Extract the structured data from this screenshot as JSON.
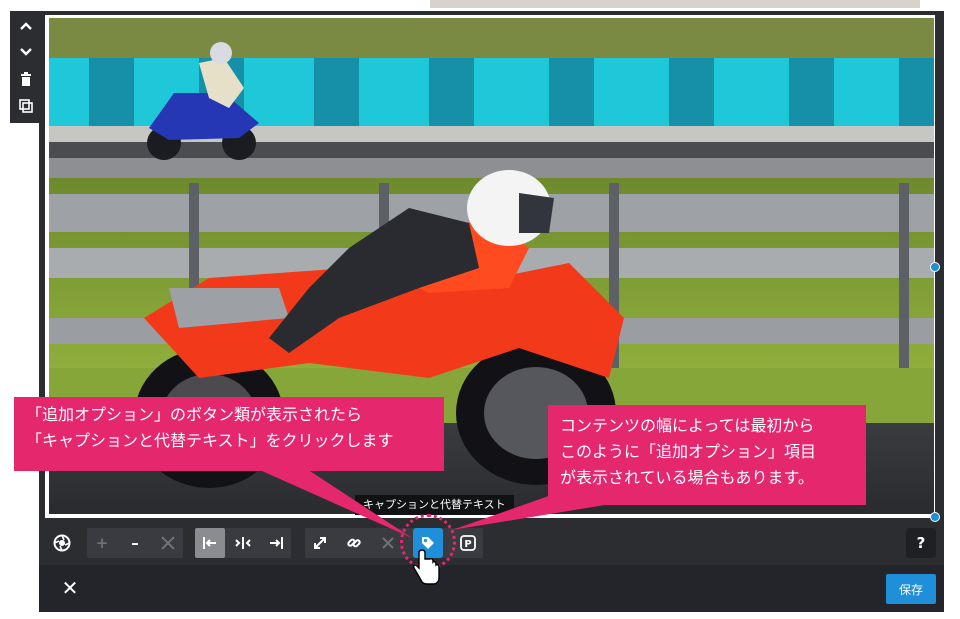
{
  "callouts": {
    "left": [
      "「追加オプション」のボタン類が表示されたら",
      "「キャプションと代替テキスト」をクリックします"
    ],
    "right": [
      "コンテンツの幅によっては最初から",
      "このように「追加オプション」項目",
      "が表示されている場合もあります。"
    ]
  },
  "tooltip": {
    "text": "キャプションと代替テキスト"
  },
  "bottombar": {
    "save_label": "保存",
    "close_label": "✕"
  },
  "toolbar": {
    "help_label": "?"
  },
  "colors": {
    "accent": "#1e8fd8",
    "callout": "#e5276e",
    "panel": "#2b2d31"
  },
  "icons": {
    "sidebar": [
      "chevron-up-icon",
      "chevron-down-icon",
      "trash-icon",
      "duplicate-icon"
    ],
    "toolbar": [
      "aperture-icon",
      "plus-icon",
      "minus-icon",
      "fullsize-icon",
      "align-left-icon",
      "align-center-icon",
      "align-right-icon",
      "resize-icon",
      "link-icon",
      "unlink-icon",
      "tag-icon",
      "pinterest-icon",
      "help-icon"
    ]
  }
}
